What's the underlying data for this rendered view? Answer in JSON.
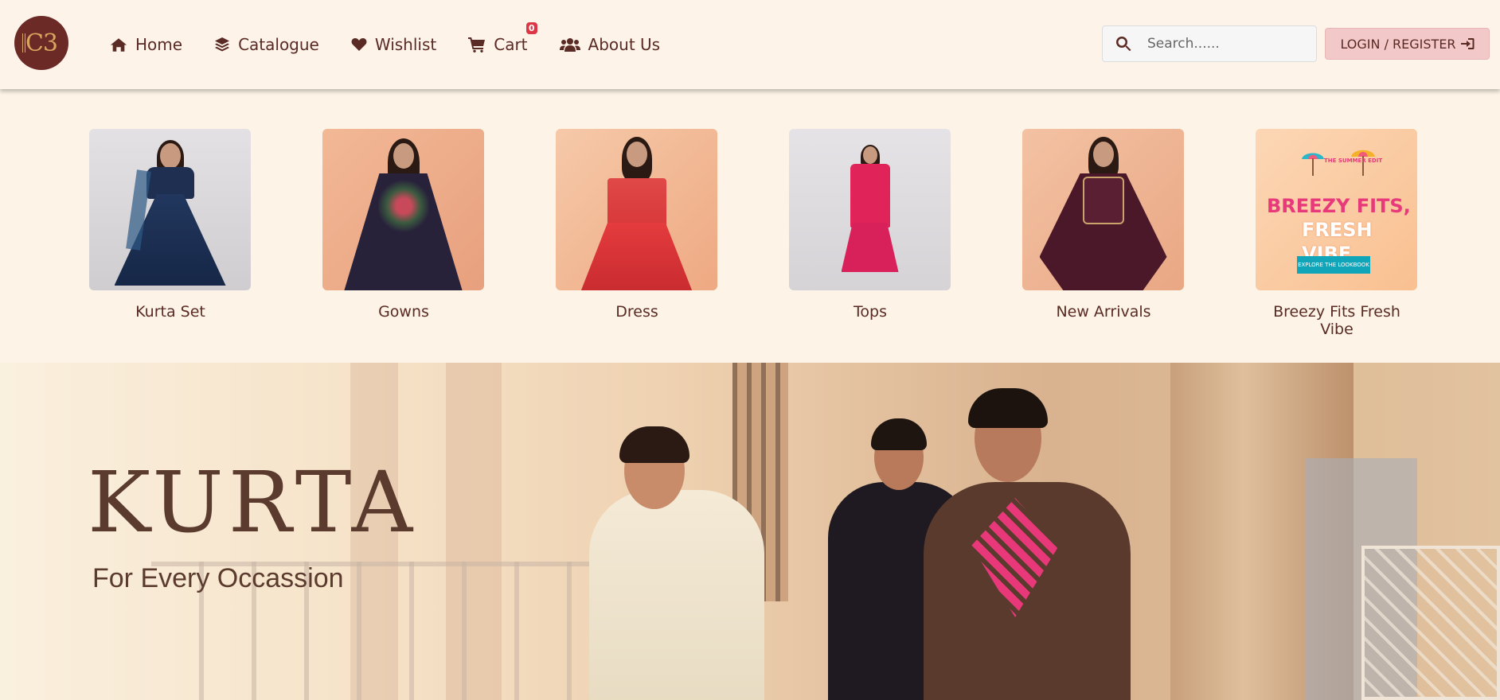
{
  "brand": {
    "logo_text": "C3"
  },
  "nav": {
    "items": [
      {
        "label": "Home",
        "icon": "home-icon"
      },
      {
        "label": "Catalogue",
        "icon": "layers-icon"
      },
      {
        "label": "Wishlist",
        "icon": "heart-icon"
      },
      {
        "label": "Cart",
        "icon": "cart-icon"
      },
      {
        "label": "About Us",
        "icon": "users-icon"
      }
    ],
    "cart_count": "0"
  },
  "search": {
    "placeholder": "Search......"
  },
  "auth": {
    "login_label": "LOGIN / REGISTER"
  },
  "categories": [
    {
      "label": "Kurta Set"
    },
    {
      "label": "Gowns"
    },
    {
      "label": "Dress"
    },
    {
      "label": "Tops"
    },
    {
      "label": "New Arrivals"
    },
    {
      "label": "Breezy Fits Fresh Vibe"
    }
  ],
  "promo": {
    "line1": "BREEZY FITS,",
    "line2": "FRESH VIBE",
    "small": "THE SUMMER EDIT",
    "button": "EXPLORE THE LOOKBOOK"
  },
  "banner": {
    "title": "KURTA",
    "subtitle": "For Every Occassion"
  },
  "colors": {
    "brand": "#6b2a25",
    "text": "#5a2a24",
    "background": "#fdf3e7",
    "login_button": "#f3c8c8",
    "badge": "#dc3545"
  }
}
